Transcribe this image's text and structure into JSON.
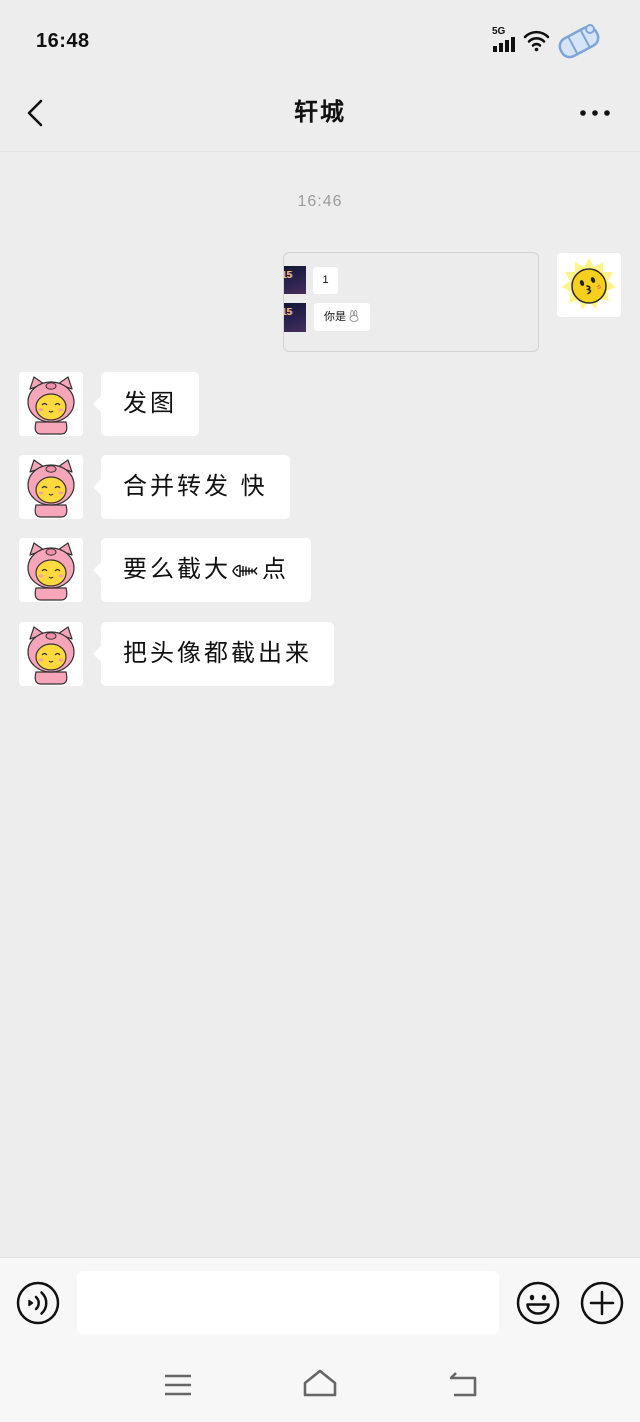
{
  "status_bar": {
    "time": "16:48",
    "network_type": "5G",
    "icons": [
      "signal-icon",
      "wifi-icon",
      "sticker-icon"
    ]
  },
  "header": {
    "title": "轩城",
    "left_icon": "back-icon",
    "right_icon": "more-icon"
  },
  "chat": {
    "timestamp": "16:46",
    "sent_messages": [
      {
        "avatar_icon": "sun-face-avatar-icon",
        "image_rows": [
          {
            "thumbnail_text": "15",
            "text": "1"
          },
          {
            "thumbnail_text": "15",
            "text": "你是",
            "trailing_icon": "rabbit-icon"
          }
        ]
      }
    ],
    "received_messages": [
      {
        "avatar_icon": "pig-hood-avatar-icon",
        "text": "发图"
      },
      {
        "avatar_icon": "pig-hood-avatar-icon",
        "text": "合并转发 快"
      },
      {
        "avatar_icon": "pig-hood-avatar-icon",
        "text_before_icon": "要么截大",
        "inline_icon": "fishbone-icon",
        "text_after_icon": "点"
      },
      {
        "avatar_icon": "pig-hood-avatar-icon",
        "text": "把头像都截出来"
      }
    ]
  },
  "input_bar": {
    "value": "",
    "left_icon": "voice-icon",
    "right_icons": [
      "emoji-icon",
      "plus-icon"
    ]
  },
  "nav_bar": {
    "icons": [
      "menu-icon",
      "home-icon",
      "back-nav-icon"
    ]
  },
  "colors": {
    "background": "#ededed",
    "bubble": "#ffffff",
    "input_bar_background": "#f7f7f7",
    "timestamp_text": "#9b9b9b"
  }
}
